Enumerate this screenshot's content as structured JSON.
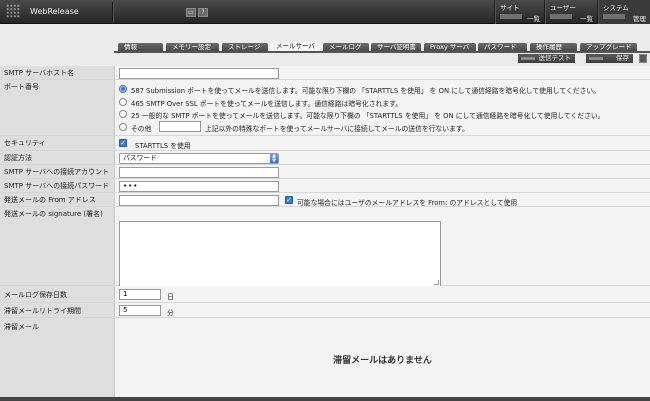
{
  "header": {
    "brand": "WebRelease",
    "icon_btn_1": "▭",
    "help_btn": "?",
    "nav": [
      {
        "caption": "サイト",
        "label": "一覧"
      },
      {
        "caption": "ユーザー",
        "label": "一覧"
      },
      {
        "caption": "システム",
        "label": "管理"
      }
    ]
  },
  "tabs": [
    "情報",
    "メモリー設定",
    "ストレージ",
    "メールサーバ",
    "メールログ",
    "サーバ証明書",
    "Proxy サーバ",
    "パスワード",
    "操作履歴",
    "アップグレード"
  ],
  "active_tab": "メールサーバ",
  "toolbar": {
    "test_label": "送信テスト",
    "save_label": "保存"
  },
  "form": {
    "smtp_host": {
      "label": "SMTP サーバホスト名",
      "value": ""
    },
    "port": {
      "label": "ポート番号",
      "options": [
        "587 Submission ポートを使ってメールを送信します。可能な限り下欄の 「STARTTLS を使用」 を ON にして通信経路を暗号化して使用してください。",
        "465 SMTP Over SSL ポートを使ってメールを送信します。通信経路は暗号化されます。",
        "25 一般的な SMTP ポートを使ってメールを送信します。可能な限り下欄の 「STARTTLS を使用」 を ON にして通信経路を暗号化して使用してください。"
      ],
      "other_label": "その他",
      "other_value": "",
      "other_desc": "上記以外の特殊なポートを使ってメールサーバに接続してメールの送信を行ないます。"
    },
    "security": {
      "label": "セキュリティ",
      "checkbox_label": "STARTTLS を使用"
    },
    "auth": {
      "label": "認証方法",
      "value": "パスワード"
    },
    "account": {
      "label": "SMTP サーバへの接続アカウント",
      "value": ""
    },
    "password": {
      "label": "SMTP サーバへの接続パスワード",
      "value": "•••"
    },
    "from": {
      "label": "発送メールの From アドレス",
      "value": "",
      "checkbox_label": "可能な場合にはユーザのメールアドレスを From: のアドレスとして使用"
    },
    "signature": {
      "label": "発送メールの signature (署名)",
      "value": ""
    },
    "log_days": {
      "label": "メールログ保存日数",
      "value": "1",
      "unit": "日"
    },
    "retry": {
      "label": "滞留メールリトライ期間",
      "value": "5",
      "unit": "分"
    },
    "queued": {
      "label": "滞留メール",
      "empty_message": "滞留メールはありません"
    }
  }
}
